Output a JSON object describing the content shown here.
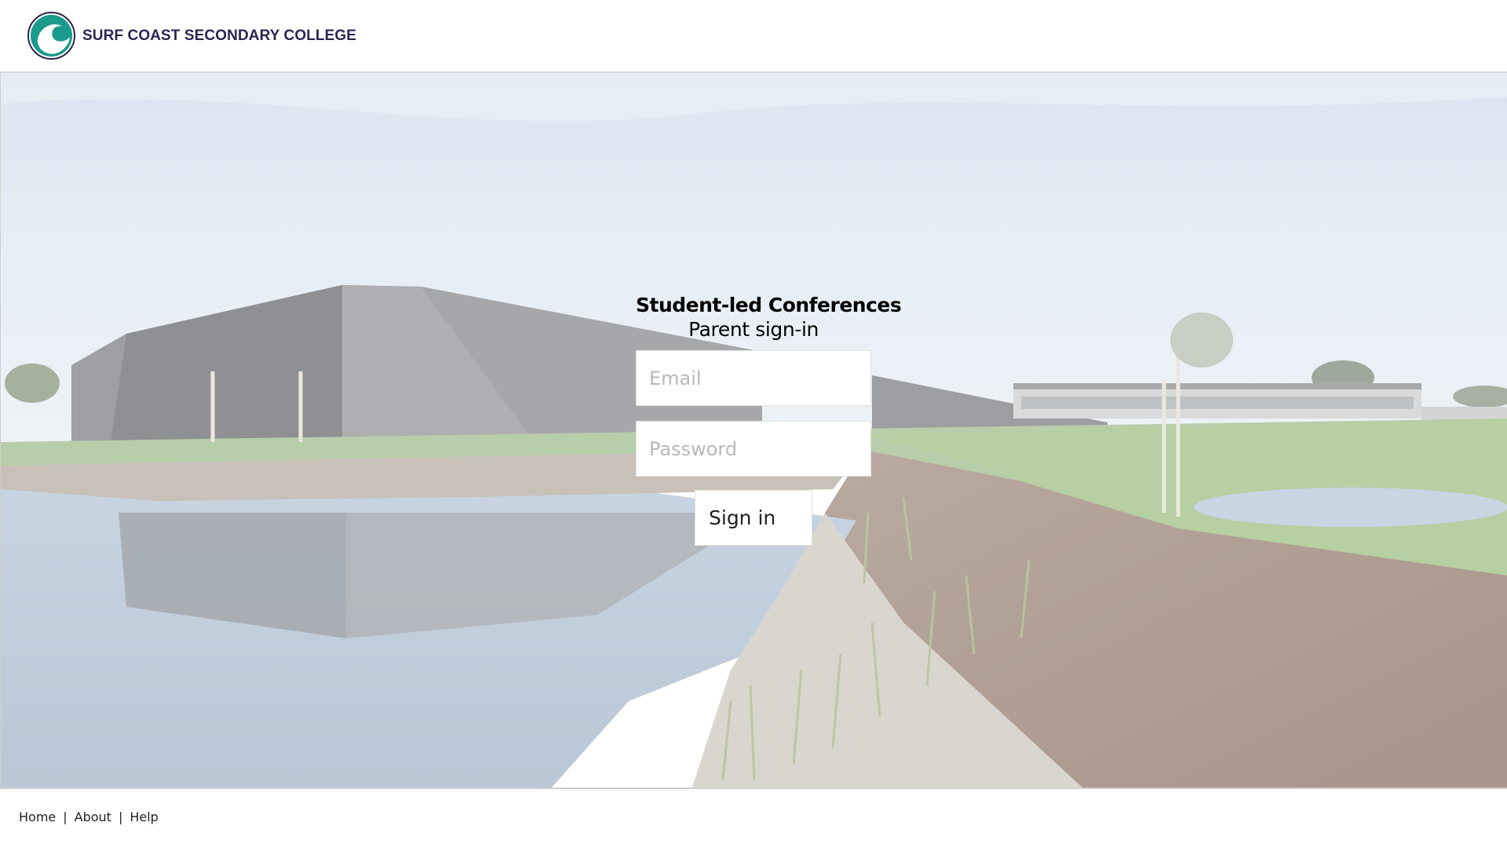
{
  "header": {
    "school_name": "SURF COAST SECONDARY COLLEGE",
    "brand_color": "#2b2450",
    "logo_colors": [
      "#1a9b8c",
      "#2b2450"
    ]
  },
  "form": {
    "title": "Student-led Conferences",
    "subtitle": "Parent sign-in",
    "email_placeholder": "Email",
    "password_placeholder": "Password",
    "signin_label": "Sign in"
  },
  "footer": {
    "links": [
      "Home",
      "About",
      "Help"
    ],
    "separator": "|"
  }
}
